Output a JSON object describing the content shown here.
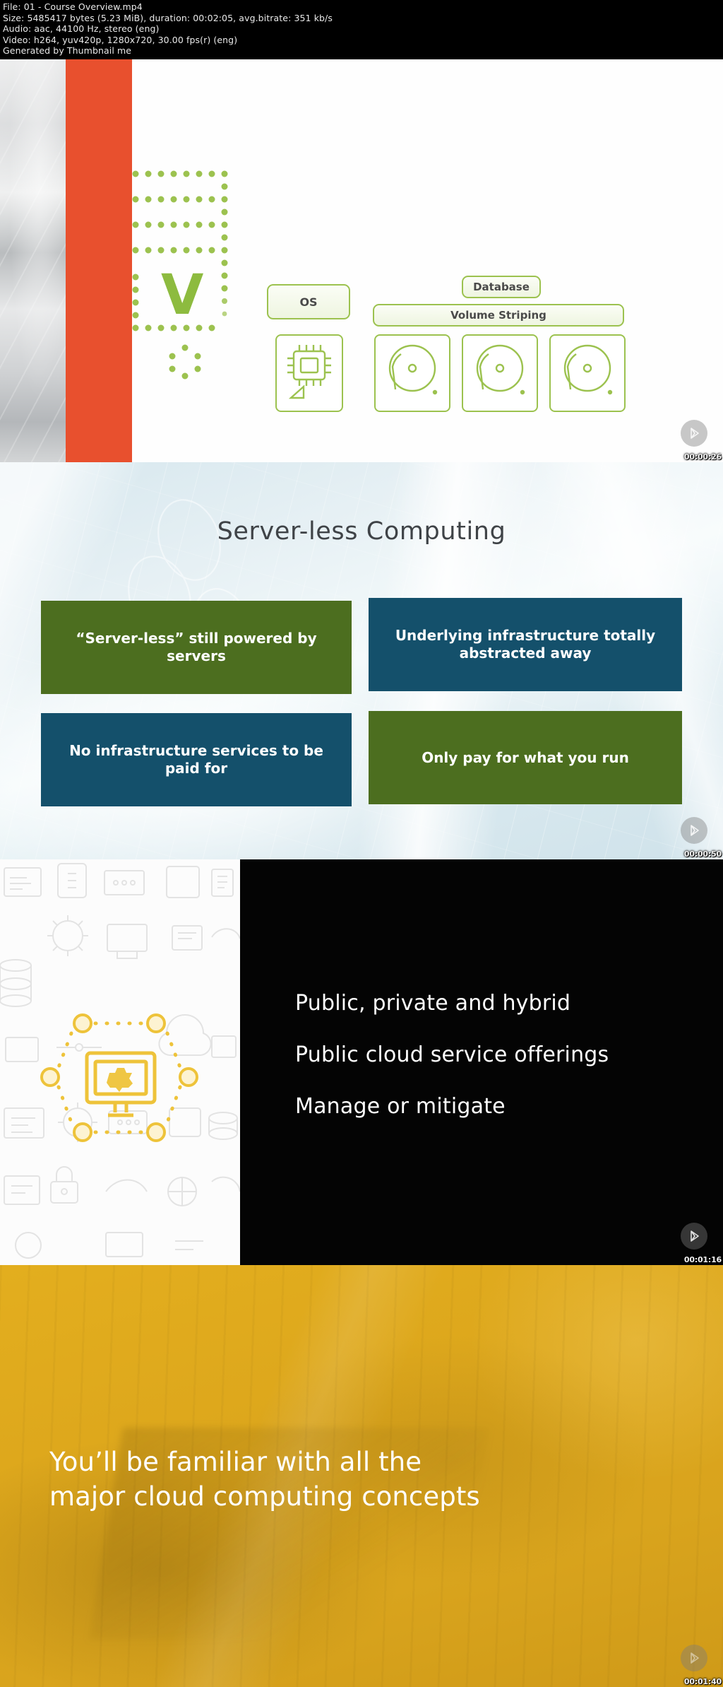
{
  "meta": {
    "file_line": "File: 01 - Course Overview.mp4",
    "size_line": "Size: 5485417 bytes (5.23 MiB), duration: 00:02:05, avg.bitrate: 351 kb/s",
    "audio_line": "Audio: aac, 44100 Hz, stereo (eng)",
    "video_line": "Video: h264, yuv420p, 1280x720, 30.00 fps(r) (eng)",
    "generator_line": "Generated by Thumbnail me"
  },
  "thumbnails": [
    {
      "timestamp": "00:00:26",
      "labels": {
        "os": "OS",
        "database": "Database",
        "volume_striping": "Volume Striping",
        "v_letter": "V"
      },
      "colors": {
        "accent_bar": "#e8502e",
        "green": "#9cc24f"
      }
    },
    {
      "timestamp": "00:00:50",
      "title": "Server-less Computing",
      "tiles": [
        {
          "text": "“Server-less” still powered by servers",
          "color": "#4c6e1f"
        },
        {
          "text": "Underlying infrastructure totally abstracted away",
          "color": "#14506b"
        },
        {
          "text": "No infrastructure services to be paid for",
          "color": "#14506b"
        },
        {
          "text": "Only pay for what you run",
          "color": "#4c6e1f"
        }
      ]
    },
    {
      "timestamp": "00:01:16",
      "bullets": [
        "Public, private and hybrid",
        "Public cloud service offerings",
        "Manage or mitigate"
      ],
      "colors": {
        "accent_bar": "#f0c22b",
        "background": "#040404"
      }
    },
    {
      "timestamp": "00:01:40",
      "hero_line_1": "You’ll be familiar with all the",
      "hero_line_2": "major cloud computing concepts",
      "colors": {
        "background": "#dca61c"
      }
    }
  ]
}
